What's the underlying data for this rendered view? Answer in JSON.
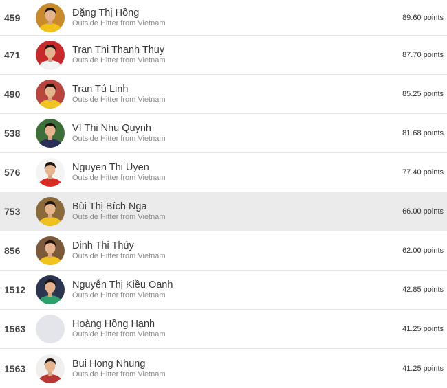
{
  "players": [
    {
      "rank": "459",
      "name": "Đặng Thị Hồng",
      "subtitle": "Outside Hitter from Vietnam",
      "points": "89.60 points",
      "avatar_bg": "#c98a2c",
      "shirt": "#f2c21c",
      "highlighted": false,
      "has_photo": true
    },
    {
      "rank": "471",
      "name": "Tran Thi Thanh Thuy",
      "subtitle": "Outside Hitter from Vietnam",
      "points": "87.70 points",
      "avatar_bg": "#c72a2a",
      "shirt": "#f4f4f4",
      "highlighted": false,
      "has_photo": true
    },
    {
      "rank": "490",
      "name": "Tran Tú Linh",
      "subtitle": "Outside Hitter from Vietnam",
      "points": "85.25 points",
      "avatar_bg": "#b8463f",
      "shirt": "#f0c51f",
      "highlighted": false,
      "has_photo": true
    },
    {
      "rank": "538",
      "name": "VI Thi Nhu Quynh",
      "subtitle": "Outside Hitter from Vietnam",
      "points": "81.68 points",
      "avatar_bg": "#3e6e3a",
      "shirt": "#2a2f57",
      "highlighted": false,
      "has_photo": true
    },
    {
      "rank": "576",
      "name": "Nguyen Thi Uyen",
      "subtitle": "Outside Hitter from Vietnam",
      "points": "77.40 points",
      "avatar_bg": "#f4f4f4",
      "shirt": "#d92a26",
      "highlighted": false,
      "has_photo": true
    },
    {
      "rank": "753",
      "name": "Bùi Thị Bích Nga",
      "subtitle": "Outside Hitter from Vietnam",
      "points": "66.00 points",
      "avatar_bg": "#8a6a3a",
      "shirt": "#f0c01e",
      "highlighted": true,
      "has_photo": true
    },
    {
      "rank": "856",
      "name": "Dinh Thi Thúy",
      "subtitle": "Outside Hitter from Vietnam",
      "points": "62.00 points",
      "avatar_bg": "#7a5a3a",
      "shirt": "#f0c41c",
      "highlighted": false,
      "has_photo": true
    },
    {
      "rank": "1512",
      "name": "Nguyễn Thị Kiều Oanh",
      "subtitle": "Outside Hitter from Vietnam",
      "points": "42.85 points",
      "avatar_bg": "#2b3550",
      "shirt": "#2fa06b",
      "highlighted": false,
      "has_photo": true
    },
    {
      "rank": "1563",
      "name": "Hoàng Hồng Hạnh",
      "subtitle": "Outside Hitter from Vietnam",
      "points": "41.25 points",
      "avatar_bg": "#e3e5ea",
      "shirt": "#e3e5ea",
      "highlighted": false,
      "has_photo": false
    },
    {
      "rank": "1563",
      "name": "Bui Hong Nhung",
      "subtitle": "Outside Hitter from Vietnam",
      "points": "41.25 points",
      "avatar_bg": "#f1efed",
      "shirt": "#b83838",
      "highlighted": false,
      "has_photo": true
    }
  ]
}
